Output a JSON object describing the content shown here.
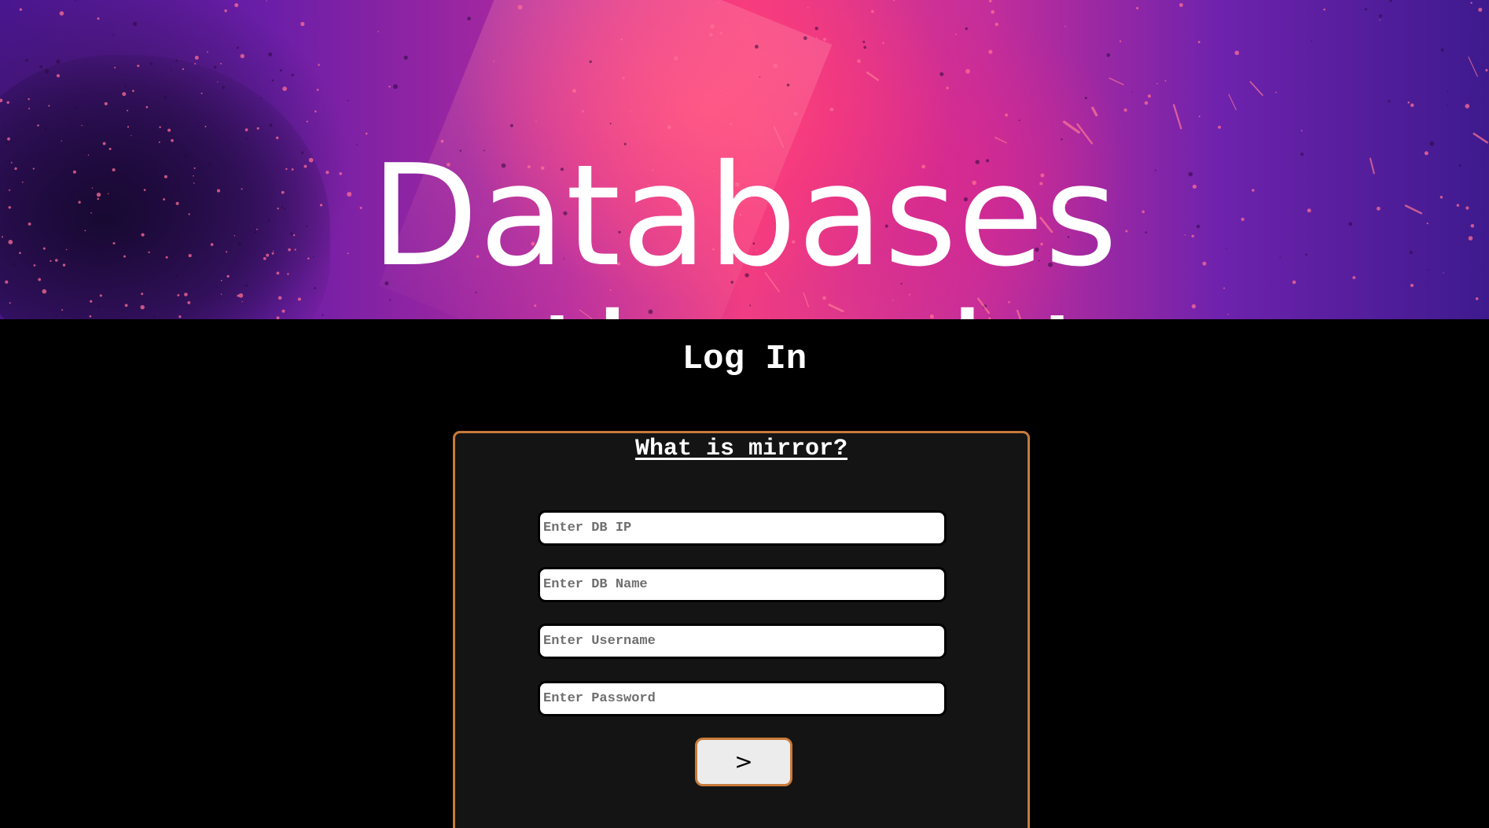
{
  "hero": {
    "title": "Databases rethought"
  },
  "page": {
    "heading": "Log In"
  },
  "login_panel": {
    "info_link": "What is mirror?",
    "fields": [
      {
        "placeholder": "Enter DB IP",
        "value": ""
      },
      {
        "placeholder": "Enter DB Name",
        "value": ""
      },
      {
        "placeholder": "Enter Username",
        "value": ""
      },
      {
        "placeholder": "Enter Password",
        "value": ""
      }
    ],
    "submit_label": ">"
  },
  "colors": {
    "background": "#000000",
    "panel_background": "#141414",
    "accent_border": "#c87a3a",
    "hero_pink": "#f03c82",
    "hero_purple": "#4a1690",
    "text": "#ffffff"
  }
}
